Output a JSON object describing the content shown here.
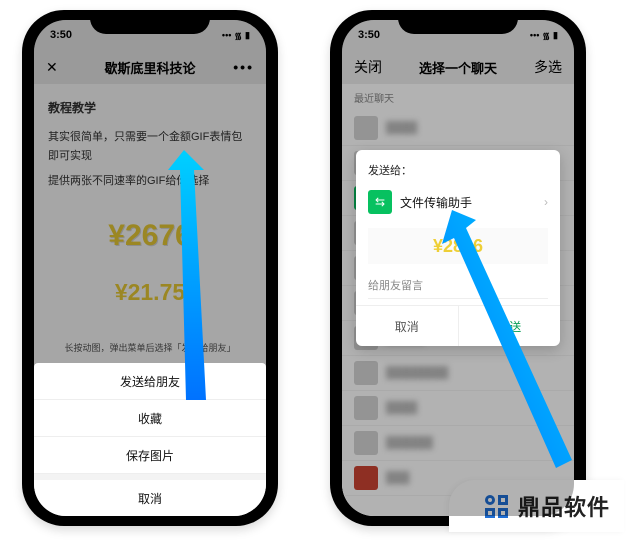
{
  "status": {
    "time": "3:50",
    "signal": "•••",
    "wifi": "᯾",
    "batt": "▮"
  },
  "left": {
    "nav": {
      "close_glyph": "✕",
      "title": "歇斯底里科技论",
      "more": "•••"
    },
    "article": {
      "heading": "教程教学",
      "line1": "其实很简单，只需要一个金额GIF表情包即可实现",
      "line2": "提供两张不同速率的GIF给你选择",
      "amt1": "¥2676",
      "amt2": "¥21.75",
      "hint": "长按动图，弹出菜单后选择「发送给朋友」"
    },
    "sheet": {
      "opt1": "发送给朋友",
      "opt2": "收藏",
      "opt3": "保存图片",
      "cancel": "取消"
    }
  },
  "right": {
    "nav": {
      "close": "关闭",
      "title": "选择一个聊天",
      "multi": "多选"
    },
    "section": "最近聊天",
    "rows": [
      {
        "name": ""
      },
      {
        "name": ""
      },
      {
        "name": "文件传输助手",
        "green": true
      },
      {
        "name": ""
      },
      {
        "name": ""
      },
      {
        "name": ""
      },
      {
        "name": ""
      },
      {
        "name": ""
      },
      {
        "name": ""
      },
      {
        "name": ""
      },
      {
        "name": ""
      }
    ],
    "dialog": {
      "title": "发送给：",
      "recipient": "文件传输助手",
      "preview": "¥28▮6",
      "placeholder": "给朋友留言",
      "cancel": "取消",
      "send": "发送"
    }
  },
  "brand": {
    "text": "鼎品软件"
  }
}
